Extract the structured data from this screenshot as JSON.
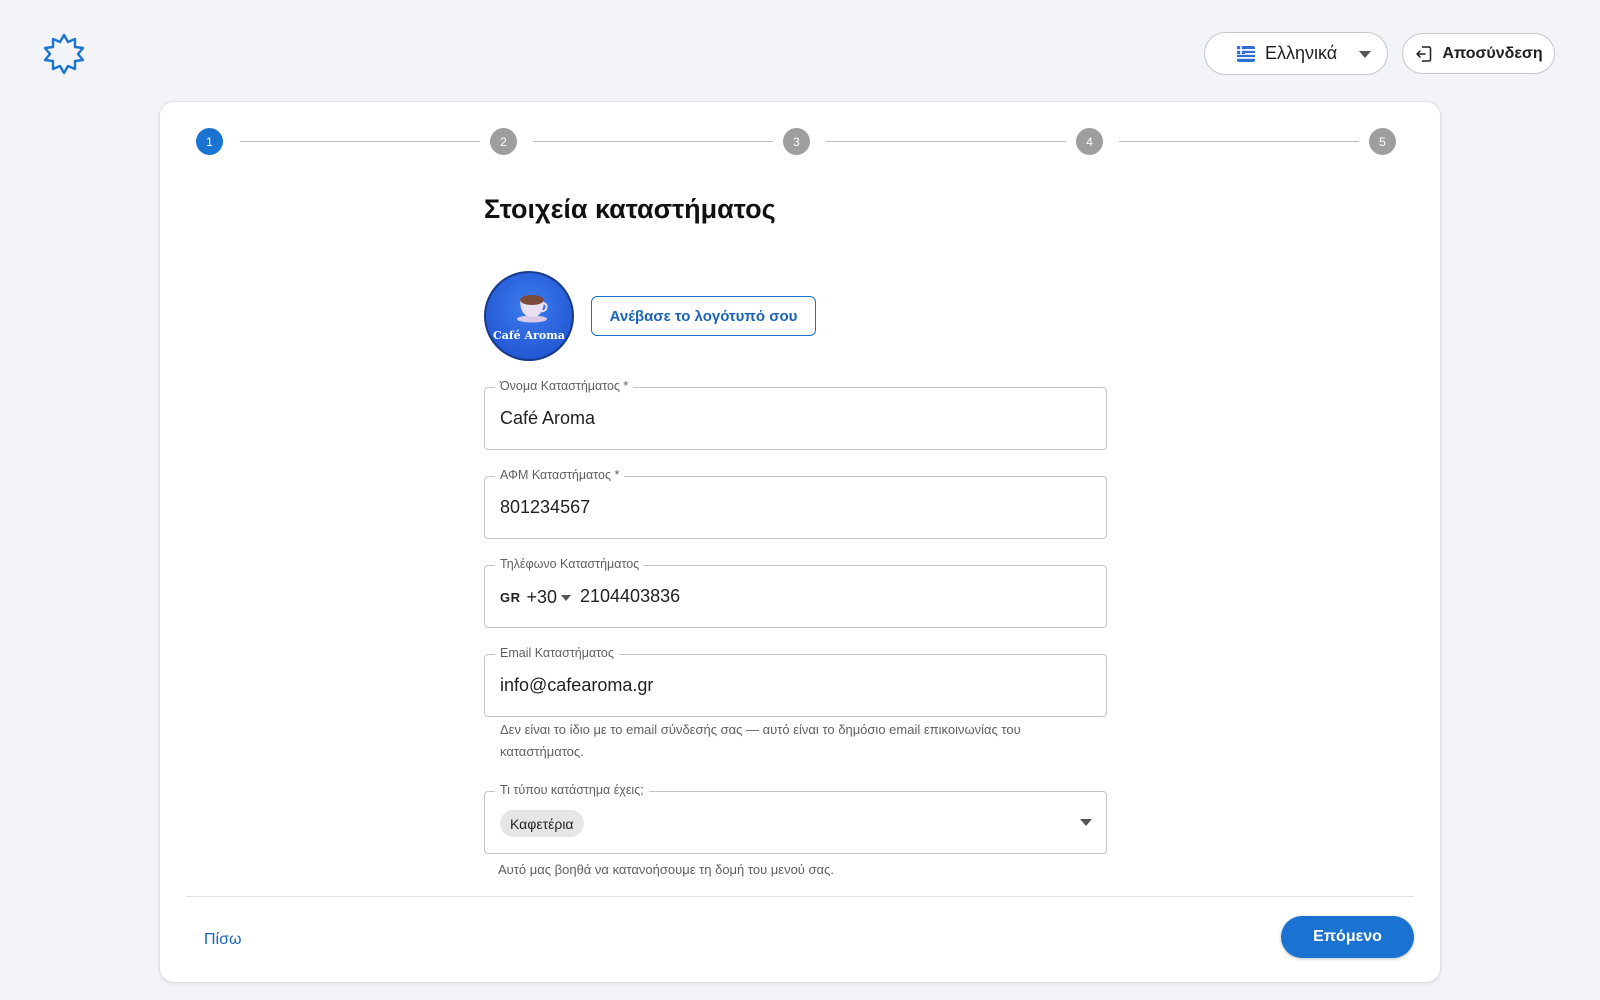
{
  "header": {
    "language": {
      "selected": "Ελληνικά",
      "flag_icon": "greece-flag-icon"
    },
    "logout_label": "Αποσύνδεση"
  },
  "stepper": {
    "steps": [
      "1",
      "2",
      "3",
      "4",
      "5"
    ],
    "active_step": 1
  },
  "form": {
    "title": "Στοιχεία καταστήματος",
    "logo_text": "Café Aroma",
    "upload_label": "Ανέβασε το λογότυπό σου",
    "store_name": {
      "label": "Όνομα Καταστήματος *",
      "value": "Café Aroma"
    },
    "vat": {
      "label": "ΑΦΜ Καταστήματος *",
      "value": "801234567"
    },
    "phone": {
      "label": "Τηλέφωνο Καταστήματος",
      "country_code": "GR",
      "dial_code": "+30",
      "value": "2104403836"
    },
    "email": {
      "label": "Email Καταστήματος",
      "value": "info@cafearoma.gr",
      "helper_line1": "Δεν είναι το ίδιο με το email σύνδεσής σας — αυτό είναι το δημόσιο email επικοινωνίας του",
      "helper_line2": "καταστήματος."
    },
    "store_type": {
      "label": "Τι τύπου κατάστημα έχεις;",
      "selected_chip": "Καφετέρια",
      "helper": "Αυτό μας βοηθά να κατανοήσουμε τη δομή του μενού σας."
    }
  },
  "footer": {
    "back_label": "Πίσω",
    "next_label": "Επόμενο"
  },
  "colors": {
    "accent": "#1a73d1",
    "step_inactive": "#9e9e9e",
    "background": "#f3f4f7"
  }
}
